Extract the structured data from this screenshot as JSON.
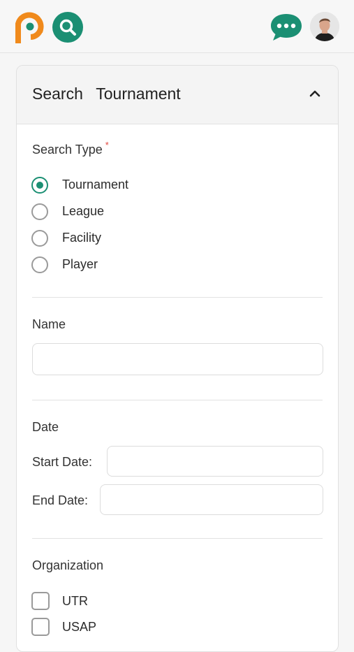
{
  "header": {
    "logo_icon": "pc-logo-icon",
    "search_icon": "search-icon",
    "chat_icon": "chat-bubble-icon",
    "avatar": "user-avatar",
    "brand_colors": {
      "orange": "#f08a1c",
      "green": "#1b8f73"
    }
  },
  "panel": {
    "title": "Search  Tournament",
    "collapse_icon": "chevron-up-icon"
  },
  "search_type": {
    "label": "Search Type",
    "required_mark": "*",
    "options": [
      {
        "label": "Tournament",
        "checked": true
      },
      {
        "label": "League",
        "checked": false
      },
      {
        "label": "Facility",
        "checked": false
      },
      {
        "label": "Player",
        "checked": false
      }
    ]
  },
  "name": {
    "label": "Name",
    "value": ""
  },
  "date": {
    "label": "Date",
    "start_label": "Start Date:",
    "start_value": "",
    "end_label": "End Date:",
    "end_value": ""
  },
  "organization": {
    "label": "Organization",
    "options": [
      {
        "label": "UTR",
        "checked": false
      },
      {
        "label": "USAP",
        "checked": false
      }
    ]
  }
}
